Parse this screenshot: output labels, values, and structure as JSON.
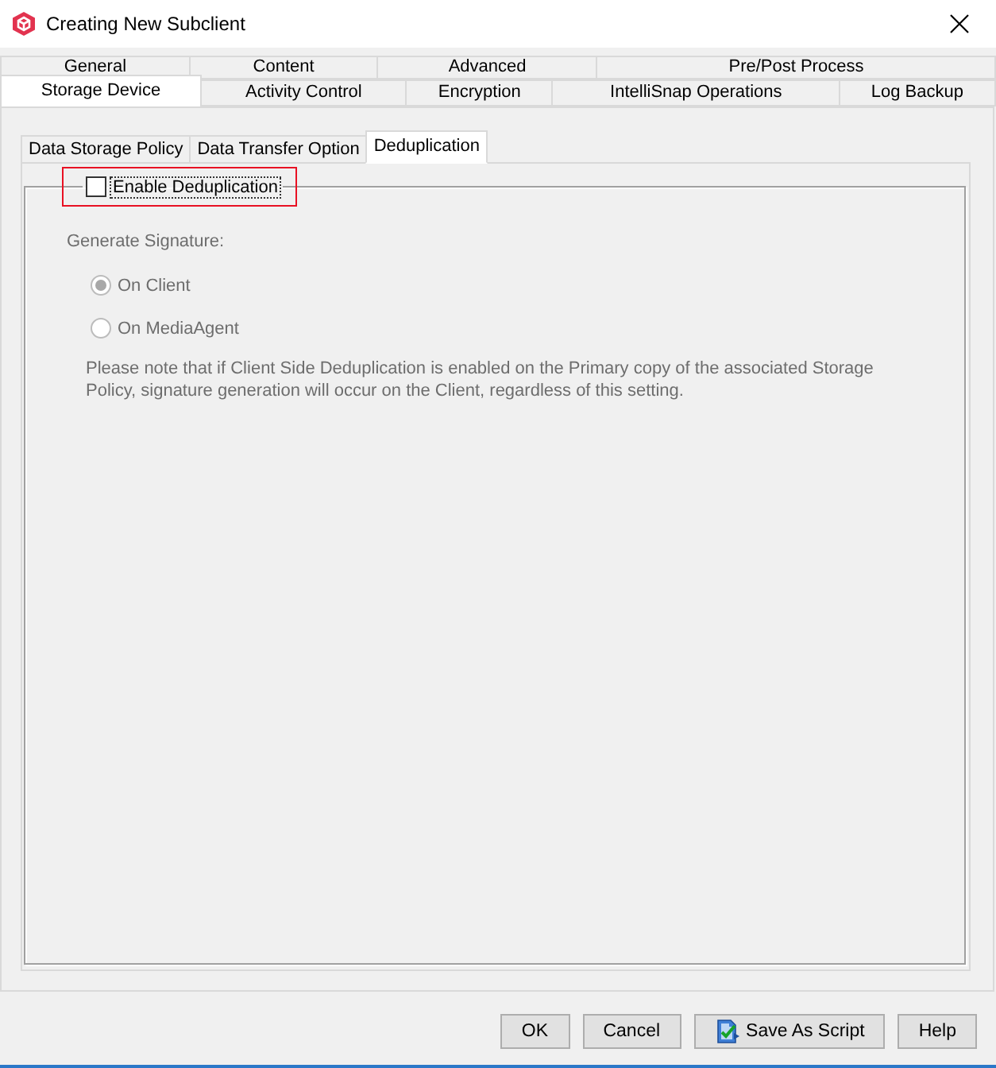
{
  "window": {
    "title": "Creating New Subclient"
  },
  "tab_rows": [
    {
      "tabs": [
        {
          "label": "General",
          "selected": false
        },
        {
          "label": "Content",
          "selected": false
        },
        {
          "label": "Advanced",
          "selected": false
        },
        {
          "label": "Pre/Post Process",
          "selected": false
        }
      ]
    },
    {
      "tabs": [
        {
          "label": "Storage Device",
          "selected": true
        },
        {
          "label": "Activity Control",
          "selected": false
        },
        {
          "label": "Encryption",
          "selected": false
        },
        {
          "label": "IntelliSnap Operations",
          "selected": false
        },
        {
          "label": "Log Backup",
          "selected": false
        }
      ]
    }
  ],
  "subtabs": [
    {
      "label": "Data Storage Policy",
      "selected": false
    },
    {
      "label": "Data Transfer Option",
      "selected": false
    },
    {
      "label": "Deduplication",
      "selected": true
    }
  ],
  "deduplication": {
    "enable": {
      "label": "Enable Deduplication",
      "checked": false,
      "focused": true,
      "highlighted": true
    },
    "signature": {
      "label": "Generate Signature:",
      "disabled": true,
      "options": [
        {
          "label": "On Client",
          "selected": true
        },
        {
          "label": "On MediaAgent",
          "selected": false
        }
      ]
    },
    "note": {
      "text": "Please note that if Client Side Deduplication is enabled on the Primary copy of the associated Storage Policy, signature generation will occur on the Client, regardless of this setting.",
      "disabled": true
    }
  },
  "buttons": [
    {
      "label": "OK",
      "kind": "plain"
    },
    {
      "label": "Cancel",
      "kind": "plain"
    },
    {
      "label": "Save As Script",
      "kind": "script"
    },
    {
      "label": "Help",
      "kind": "plain"
    }
  ]
}
